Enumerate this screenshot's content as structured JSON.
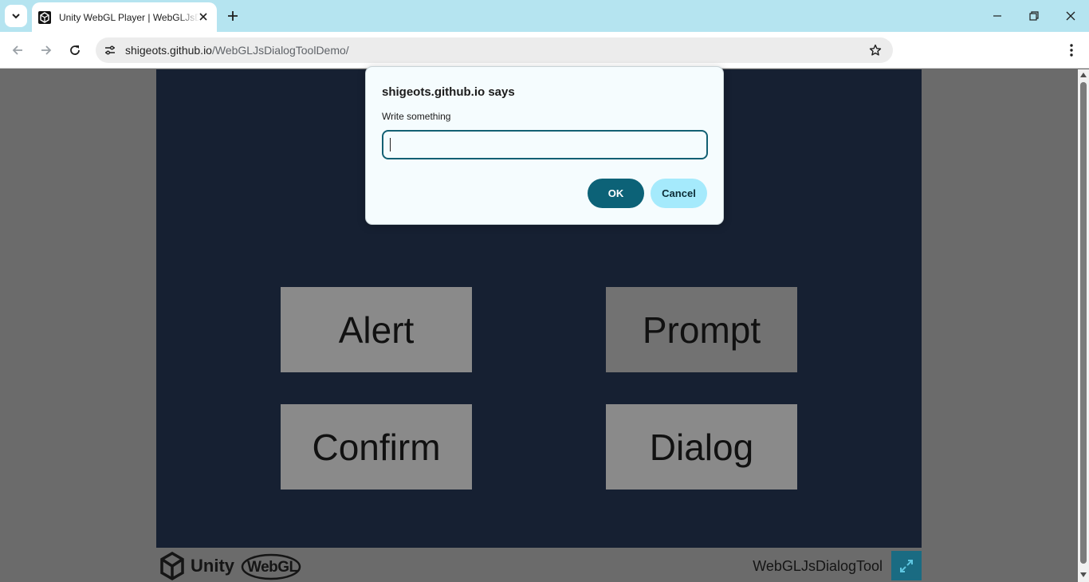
{
  "browser": {
    "tab": {
      "title": "Unity WebGL Player | WebGLJsDialogToolDemo"
    },
    "address": {
      "host": "shigeots.github.io",
      "path": "/WebGLJsDialogToolDemo/"
    }
  },
  "game": {
    "buttons": {
      "alert": "Alert",
      "prompt": "Prompt",
      "confirm": "Confirm",
      "dialog": "Dialog"
    },
    "footer": {
      "unity_text": "Unity",
      "webgl_text": "WebGL",
      "build_title": "WebGLJsDialogTool"
    }
  },
  "dialog": {
    "title": "shigeots.github.io says",
    "message": "Write something",
    "input_value": "",
    "ok_label": "OK",
    "cancel_label": "Cancel"
  },
  "colors": {
    "tabstrip": "#b5e4f0",
    "canvas": "#162032",
    "dialog_primary": "#0c6277",
    "dialog_secondary": "#a5eafc",
    "fullscreen_button": "#1a6b82"
  }
}
